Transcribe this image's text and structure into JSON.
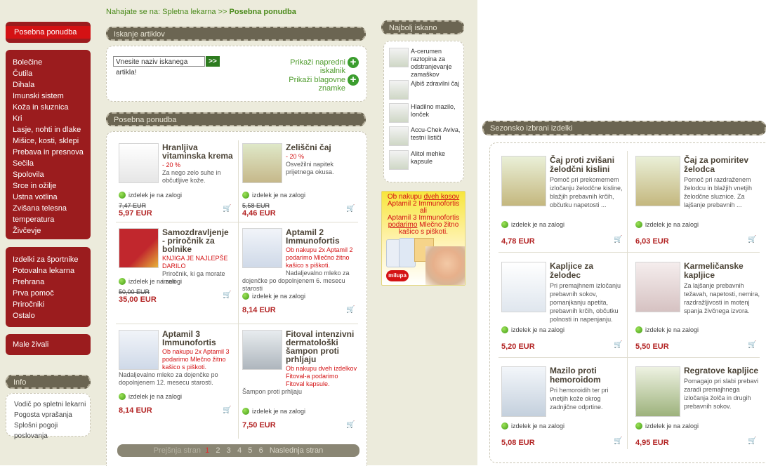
{
  "breadcrumb": {
    "prefix": "Nahajate se na: Spletna lekarna >>",
    "current": "Posebna ponudba"
  },
  "left_menu": {
    "promo": "Posebna ponudba",
    "group1": [
      "Bolečine",
      "Čutila",
      "Dihala",
      "Imunski sistem",
      "Koža in sluznica",
      "Kri",
      "Lasje, nohti in dlake",
      "Mišice, kosti, sklepi",
      "Prebava in presnova",
      "Sečila",
      "Spolovila",
      "Srce in ožilje",
      "Ustna votlina",
      "Zvišana telesna temperatura",
      "Živčevje"
    ],
    "group2": [
      "Izdelki za športnike",
      "Potovalna lekarna",
      "Prehrana",
      "Prva pomoč",
      "Priročniki",
      "Ostalo"
    ],
    "group3": [
      "Male živali"
    ],
    "info_title": "Info",
    "info_items": [
      "Vodič po spletni lekarni",
      "Pogosta vprašanja",
      "Splošni pogoji poslovanja"
    ]
  },
  "search": {
    "title": "Iskanje artiklov",
    "placeholder": "Vnesite naziv iskanega artikla!",
    "go": ">>",
    "advanced": "Prikaži napredni iskalnik",
    "brands": "Prikaži blagovne znamke"
  },
  "special": {
    "title": "Posebna ponudba",
    "stock_text": "izdelek je na zalogi",
    "products": [
      {
        "title": "Hranljiva vitaminska krema",
        "discount": "- 20 %",
        "desc": "Za nego zelo suhe in občutljive kože.",
        "old": "7,47 EUR",
        "price": "5,97 EUR"
      },
      {
        "title": "Zeliščni čaj",
        "discount": "- 20 %",
        "desc": "Osvežilni napitek prijetnega okusa.",
        "old": "5,58 EUR",
        "price": "4,46 EUR"
      },
      {
        "title": "Samozdravljenje - priročnik za bolnike",
        "discount": "KNJIGA JE NAJLEPŠE DARILO",
        "desc": "Priročnik, ki ga morate imeti",
        "old": "50,00 EUR",
        "price": "35,00 EUR"
      },
      {
        "title": "Aptamil 2 Immunofortis",
        "discount": "Ob nakupu 2x Aptamil 2 podarimo Mlečno žitno kašico s piškoti.",
        "desc": "Nadaljevalno mleko za dojenčke po dopolnjenem 6. mesecu starosti",
        "old": "",
        "price": "8,14 EUR"
      },
      {
        "title": "Aptamil 3 Immunofortis",
        "discount": "Ob nakupu 2x Aptamil 3 podarimo Mlečno žitno kašico s piškoti.",
        "desc": "Nadaljevalno mleko za dojenčke po dopolnjenem 12. mesecu starosti.",
        "old": "",
        "price": "8,14 EUR"
      },
      {
        "title": "Fitoval intenzivni dermatološki šampon proti prhljaju",
        "discount": "Ob nakupu dveh izdelkov Fitoval-a podarimo Fitoval kapsule.",
        "desc": "Šampon proti prhljaju",
        "old": "",
        "price": "7,50 EUR"
      }
    ]
  },
  "pagination": {
    "prev": "Prejšnja stran",
    "pages": [
      "1",
      "2",
      "3",
      "4",
      "5",
      "6"
    ],
    "next": "Naslednja stran"
  },
  "most_searched": {
    "title": "Najbolj iskano",
    "items": [
      "A-cerumen raztopina za odstranjevanje zamaškov",
      "Ajbiš zdravilni čaj",
      "Hladilno mazilo, lonček",
      "Accu-Chek Aviva, testni lističi",
      "Alitol mehke kapsule"
    ]
  },
  "banner": {
    "line1": "Ob nakupu ",
    "line1u": "dveh kosov",
    "line2": "Aptamil 2 Immunofortis",
    "line3": "ali",
    "line4": "Aptamil 3 Immunofortis",
    "line5u": "podarimo",
    "line5": " Mlečno žitno",
    "line6": "kašico s piškoti.",
    "brand": "milupa"
  },
  "seasonal": {
    "title": "Sezonsko izbrani izdelki",
    "stock_text": "izdelek je na zalogi",
    "products": [
      {
        "title": "Čaj proti zvišani želodčni kislini",
        "desc": "Pomoč pri prekomernem izločanju želodčne kisline, blažjih prebavnih krčih, občutku napetosti ...",
        "price": "4,78 EUR"
      },
      {
        "title": "Čaj za pomiritev želodca",
        "desc": "Pomoč pri razdraženem želodcu in blažjih vnetjih želodčne sluznice. Za lajšanje prebavnih ...",
        "price": "6,03 EUR"
      },
      {
        "title": "Kapljice za želodec",
        "desc": "Pri premajhnem izločanju prebavnih sokov, pomanjkanju apetita, prebavnih krčih, občutku polnosti in napenjanju.",
        "price": "5,20 EUR"
      },
      {
        "title": "Karmeličanske kapljice",
        "desc": "Za lajšanje prebavnih težavah, napetosti, nemira, razdražljivosti in motenj spanja živčnega izvora.",
        "price": "5,50 EUR"
      },
      {
        "title": "Mazilo proti hemoroidom",
        "desc": "Pri hemoroidih ter pri vnetjih kože okrog zadnjične odprtine.",
        "price": "5,08 EUR"
      },
      {
        "title": "Regratove kapljice",
        "desc": "Pomagajo pri slabi prebavi zaradi premajhnega izločanja žolča in drugih prebavnih sokov.",
        "price": "4,95 EUR"
      }
    ]
  },
  "colors": {
    "menu_red": "#9b1c1e",
    "promo_red": "#d41214",
    "price_red": "#b32424",
    "link_green": "#4c9a2a",
    "pill_gray": "#6b6552",
    "page_bg": "#ecebdc"
  },
  "icons": {
    "cart": "cart-icon",
    "plus": "plus-circle-icon",
    "stock": "stock-dot-icon"
  }
}
